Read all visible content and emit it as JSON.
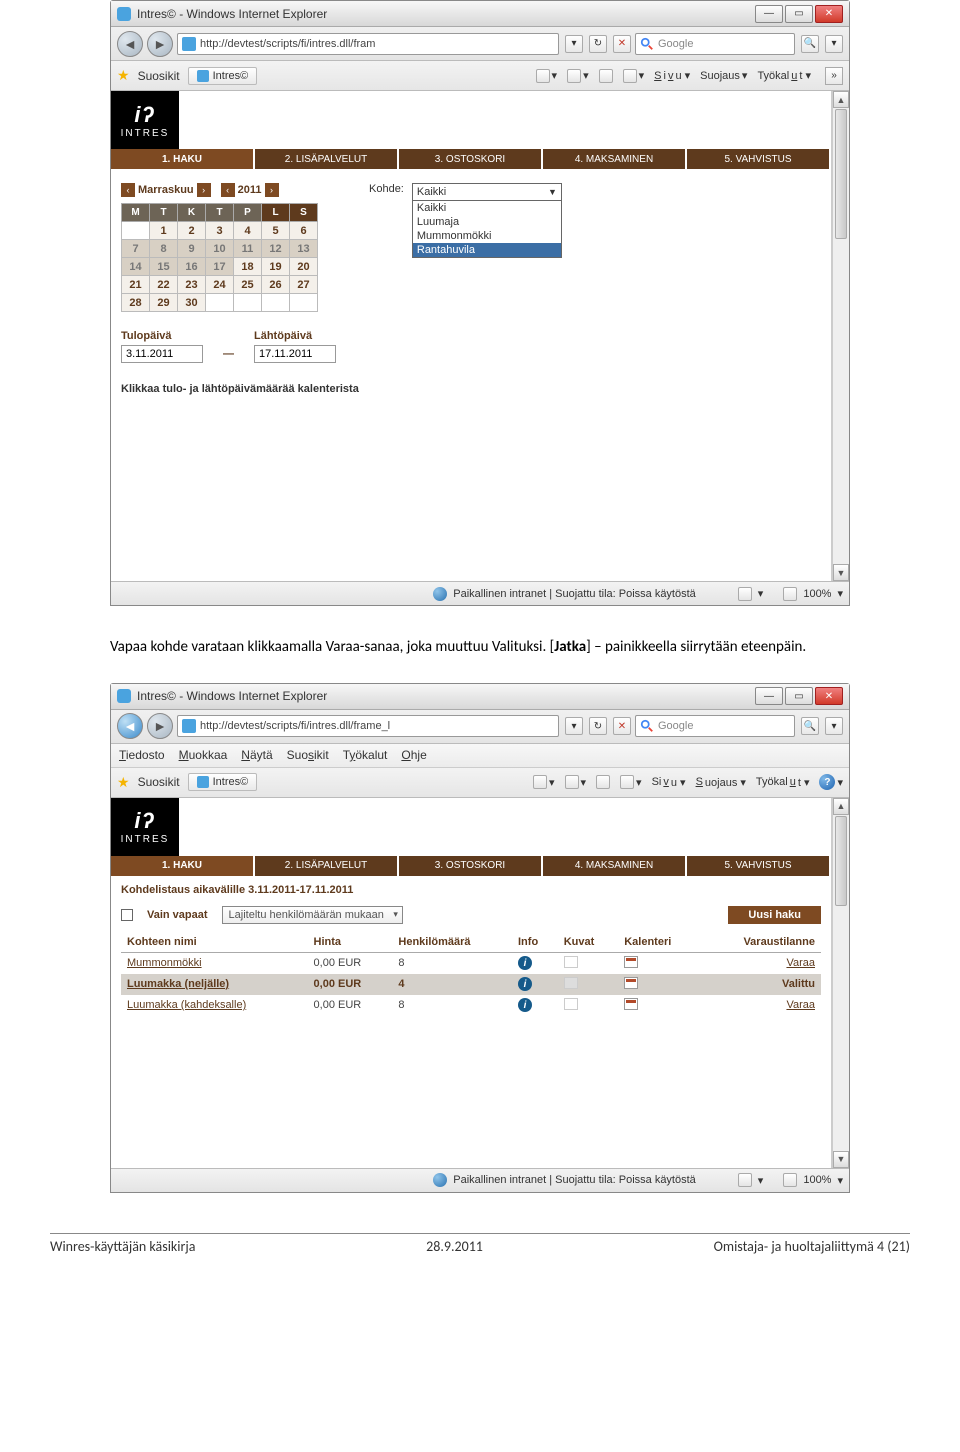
{
  "ie1": {
    "title": "Intres© - Windows Internet Explorer",
    "url": "http://devtest/scripts/fi/intres.dll/fram",
    "search_placeholder": "Google",
    "fav_label": "Suosikit",
    "tab_label": "Intres©",
    "tools": {
      "sivu": "Sivu",
      "suojaus": "Suojaus",
      "tyokalut": "Työkalut"
    },
    "status": "Paikallinen intranet | Suojattu tila: Poissa käytöstä",
    "zoom": "100%"
  },
  "intres": {
    "logo_sub": "INTRES",
    "tabs": [
      "1. HAKU",
      "2. LISÄPALVELUT",
      "3. OSTOSKORI",
      "4. MAKSAMINEN",
      "5. VAHVISTUS"
    ],
    "month": "Marraskuu",
    "year": "2011",
    "days": [
      "M",
      "T",
      "K",
      "T",
      "P",
      "L",
      "S"
    ],
    "cal": [
      [
        "",
        "1",
        "2",
        "3",
        "4",
        "5",
        "6"
      ],
      [
        "7",
        "8",
        "9",
        "10",
        "11",
        "12",
        "13"
      ],
      [
        "14",
        "15",
        "16",
        "17",
        "18",
        "19",
        "20"
      ],
      [
        "21",
        "22",
        "23",
        "24",
        "25",
        "26",
        "27"
      ],
      [
        "28",
        "29",
        "30",
        "",
        "",
        "",
        ""
      ]
    ],
    "tulo_lbl": "Tulopäivä",
    "lahto_lbl": "Lähtöpäivä",
    "tulo": "3.11.2011",
    "lahto": "17.11.2011",
    "instr": "Klikkaa tulo- ja lähtöpäivämäärää kalenterista",
    "kohde_lbl": "Kohde:",
    "dd_sel": "Kaikki",
    "dd_opts": [
      "Kaikki",
      "Luumaja",
      "Mummonmökki",
      "Rantahuvila"
    ]
  },
  "body_text": {
    "line1a": "Vapaa kohde varataan klikkaamalla Varaa-sanaa, joka muuttuu Valituksi. [",
    "line1b": "Jatka",
    "line1c": "] – painikkeella siirrytään eteenpäin."
  },
  "ie2": {
    "menus": [
      "Tiedosto",
      "Muokkaa",
      "Näytä",
      "Suosikit",
      "Työkalut",
      "Ohje"
    ],
    "url": "http://devtest/scripts/fi/intres.dll/frame_l"
  },
  "listing": {
    "title": "Kohdelistaus aikavälille 3.11.2011-17.11.2011",
    "vain_vapaat": "Vain vapaat",
    "sort": "Lajiteltu henkilömäärän mukaan",
    "uusi_haku": "Uusi haku",
    "cols": [
      "Kohteen nimi",
      "Hinta",
      "Henkilömäärä",
      "Info",
      "Kuvat",
      "Kalenteri",
      "Varaustilanne"
    ],
    "rows": [
      {
        "name": "Mummonmökki",
        "price": "0,00 EUR",
        "pax": "8",
        "status": "Varaa"
      },
      {
        "name": "Luumakka (neljälle)",
        "price": "0,00 EUR",
        "pax": "4",
        "status": "Valittu"
      },
      {
        "name": "Luumakka (kahdeksalle)",
        "price": "0,00 EUR",
        "pax": "8",
        "status": "Varaa"
      }
    ]
  },
  "footer": {
    "left": "Winres-käyttäjän käsikirja",
    "center": "28.9.2011",
    "right": "Omistaja- ja huoltajaliittymä 4 (21)"
  }
}
